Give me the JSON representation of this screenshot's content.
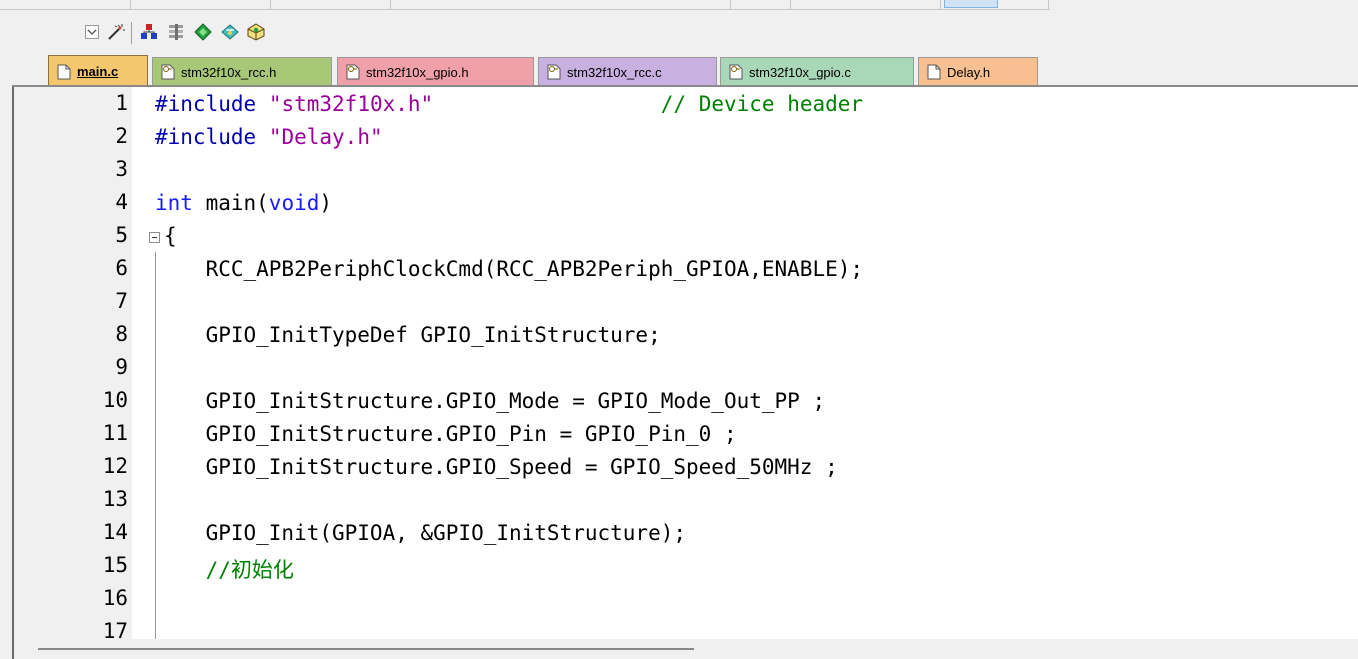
{
  "toolbar": {
    "icons": [
      "dropdown-icon",
      "magic-wand-icon",
      "manage-components-icon",
      "pack-installer-icon",
      "select-software-packs-icon",
      "run-time-environment-icon",
      "package-icon"
    ]
  },
  "tabs": [
    {
      "label": "main.c",
      "active": true,
      "color": "#f4c66e"
    },
    {
      "label": "stm32f10x_rcc.h",
      "active": false,
      "color": "#a8c878"
    },
    {
      "label": "stm32f10x_gpio.h",
      "active": false,
      "color": "#f0a0a8"
    },
    {
      "label": "stm32f10x_rcc.c",
      "active": false,
      "color": "#c8b0e0"
    },
    {
      "label": "stm32f10x_gpio.c",
      "active": false,
      "color": "#a8d8b8"
    },
    {
      "label": "Delay.h",
      "active": false,
      "color": "#f8c090"
    }
  ],
  "editor": {
    "lines": [
      {
        "num": "1",
        "text": "#include \"stm32f10x.h\"                  // Device header"
      },
      {
        "num": "2",
        "text": "#include \"Delay.h\""
      },
      {
        "num": "3",
        "text": ""
      },
      {
        "num": "4",
        "text": "int main(void)"
      },
      {
        "num": "5",
        "text": "{"
      },
      {
        "num": "6",
        "text": "    RCC_APB2PeriphClockCmd(RCC_APB2Periph_GPIOA,ENABLE);"
      },
      {
        "num": "7",
        "text": ""
      },
      {
        "num": "8",
        "text": "    GPIO_InitTypeDef GPIO_InitStructure;"
      },
      {
        "num": "9",
        "text": ""
      },
      {
        "num": "10",
        "text": "    GPIO_InitStructure.GPIO_Mode = GPIO_Mode_Out_PP ;"
      },
      {
        "num": "11",
        "text": "    GPIO_InitStructure.GPIO_Pin = GPIO_Pin_0 ;"
      },
      {
        "num": "12",
        "text": "    GPIO_InitStructure.GPIO_Speed = GPIO_Speed_50MHz ;"
      },
      {
        "num": "13",
        "text": ""
      },
      {
        "num": "14",
        "text": "    GPIO_Init(GPIOA, &GPIO_InitStructure);"
      },
      {
        "num": "15",
        "text": "    //初始化"
      },
      {
        "num": "16",
        "text": ""
      },
      {
        "num": "17",
        "text": ""
      }
    ]
  },
  "colors": {
    "keyword": "#1a1aff",
    "string": "#990099",
    "comment": "#008000",
    "preprocessor": "#0000b0"
  }
}
